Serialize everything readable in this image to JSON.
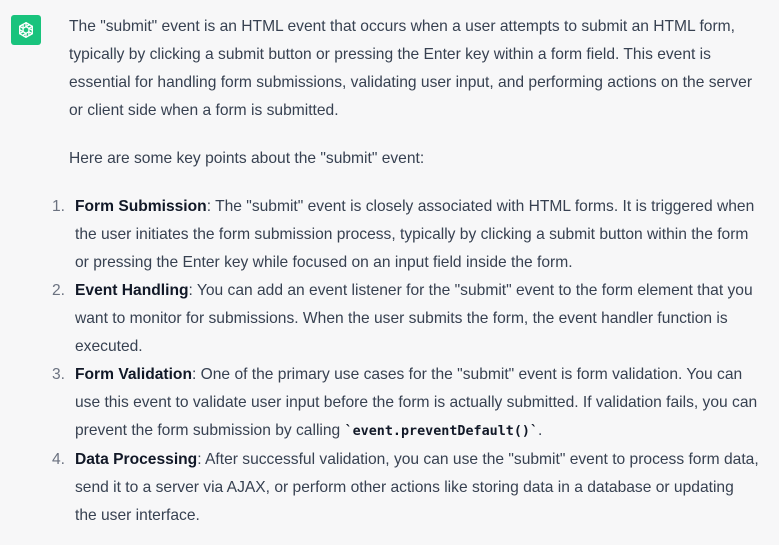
{
  "avatar": {
    "icon": "openai-logo-icon",
    "color": "#19c37d"
  },
  "intro": "The \"submit\" event is an HTML event that occurs when a user attempts to submit an HTML form, typically by clicking a submit button or pressing the Enter key within a form field. This event is essential for handling form submissions, validating user input, and performing actions on the server or client side when a form is submitted.",
  "lead": "Here are some key points about the \"submit\" event:",
  "points": [
    {
      "num": "1.",
      "term": "Form Submission",
      "text": ": The \"submit\" event is closely associated with HTML forms. It is triggered when the user initiates the form submission process, typically by clicking a submit button within the form or pressing the Enter key while focused on an input field inside the form."
    },
    {
      "num": "2.",
      "term": "Event Handling",
      "text": ": You can add an event listener for the \"submit\" event to the form element that you want to monitor for submissions. When the user submits the form, the event handler function is executed."
    },
    {
      "num": "3.",
      "term": "Form Validation",
      "text": ": One of the primary use cases for the \"submit\" event is form validation. You can use this event to validate user input before the form is actually submitted. If validation fails, you can prevent the form submission by calling ",
      "code": "`event.preventDefault()`",
      "after": "."
    },
    {
      "num": "4.",
      "term": "Data Processing",
      "text": ": After successful validation, you can use the \"submit\" event to process form data, send it to a server via AJAX, or perform other actions like storing data in a database or updating the user interface."
    }
  ]
}
